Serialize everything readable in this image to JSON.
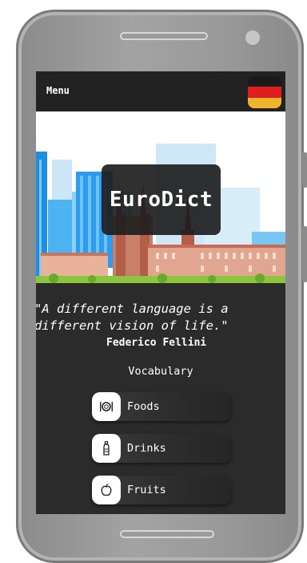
{
  "header": {
    "menu_label": "Menu",
    "language_flag": "germany-flag",
    "flag_colors": [
      "#1a1a1a",
      "#dd1f1f",
      "#f0b52a"
    ]
  },
  "banner": {
    "app_name": "EuroDict"
  },
  "quote": {
    "text": "\"A different language is a\ndifferent vision of life.\"",
    "author": "Federico Fellini"
  },
  "vocabulary": {
    "title": "Vocabulary",
    "categories": [
      {
        "label": "Foods",
        "icon": "cutlery-icon"
      },
      {
        "label": "Drinks",
        "icon": "bottle-icon"
      },
      {
        "label": "Fruits",
        "icon": "apple-icon"
      }
    ]
  }
}
